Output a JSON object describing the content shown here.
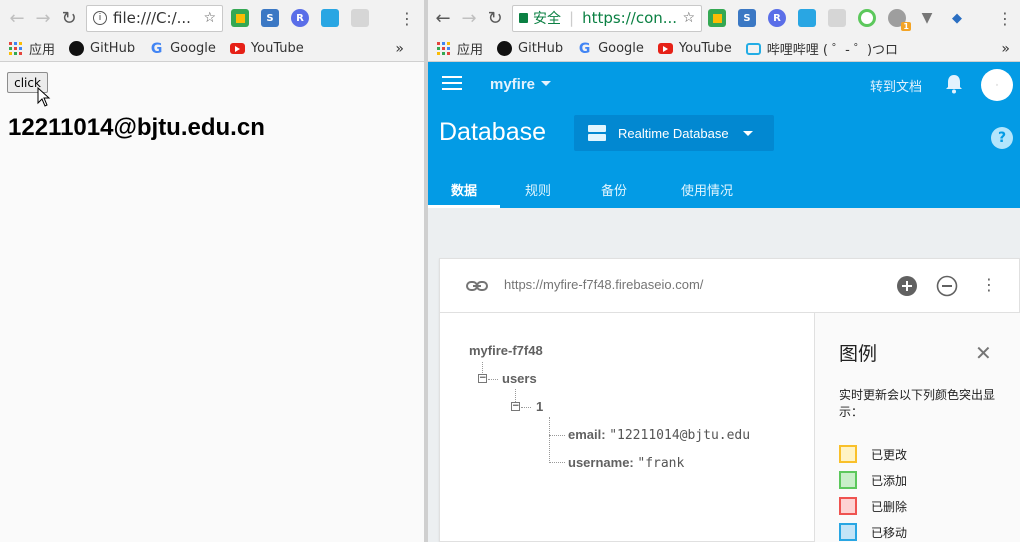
{
  "left_browser": {
    "address": "file:///C:/...",
    "bookmarks": [
      {
        "label": "应用",
        "icon": "apps-grid-icon"
      },
      {
        "label": "GitHub",
        "icon": "github-icon"
      },
      {
        "label": "Google",
        "icon": "google-icon"
      },
      {
        "label": "YouTube",
        "icon": "youtube-icon"
      }
    ],
    "overflow": "»"
  },
  "left_page": {
    "button_label": "click",
    "heading": "12211014@bjtu.edu.cn"
  },
  "right_browser": {
    "security_label": "安全",
    "address": "https://con...",
    "bookmarks": [
      {
        "label": "应用",
        "icon": "apps-grid-icon"
      },
      {
        "label": "GitHub",
        "icon": "github-icon"
      },
      {
        "label": "Google",
        "icon": "google-icon"
      },
      {
        "label": "YouTube",
        "icon": "youtube-icon"
      },
      {
        "label": "哔哩哔哩 ( ゜- ゜)つロ",
        "icon": "bilibili-icon"
      }
    ],
    "overflow": "»",
    "extension_badge": "1"
  },
  "firebase": {
    "project": "myfire",
    "docs_link": "转到文档",
    "title": "Database",
    "db_selector": "Realtime Database",
    "help": "?",
    "tabs": [
      "数据",
      "规则",
      "备份",
      "使用情况"
    ],
    "active_tab": "数据",
    "db_url": "https://myfire-f7f48.firebaseio.com/",
    "tree": {
      "root": "myfire-f7f48",
      "users": "users",
      "child": "1",
      "email_key": "email:",
      "email_value": "\"12211014@bjtu.edu",
      "username_key": "username:",
      "username_value": "\"frank"
    },
    "legend": {
      "title": "图例",
      "description": "实时更新会以下列颜色突出显示：",
      "items": [
        {
          "label": "已更改",
          "fill": "#fff3c4",
          "border": "#f9c02a"
        },
        {
          "label": "已添加",
          "fill": "#c8efc8",
          "border": "#5cc85c"
        },
        {
          "label": "已删除",
          "fill": "#fdd3d3",
          "border": "#ef5350"
        },
        {
          "label": "已移动",
          "fill": "#c4e4f7",
          "border": "#29a6e3"
        }
      ]
    }
  },
  "colors": {
    "firebase_blue": "#039be5",
    "selector_blue": "#0288d1",
    "secure_green": "#0b8043"
  }
}
